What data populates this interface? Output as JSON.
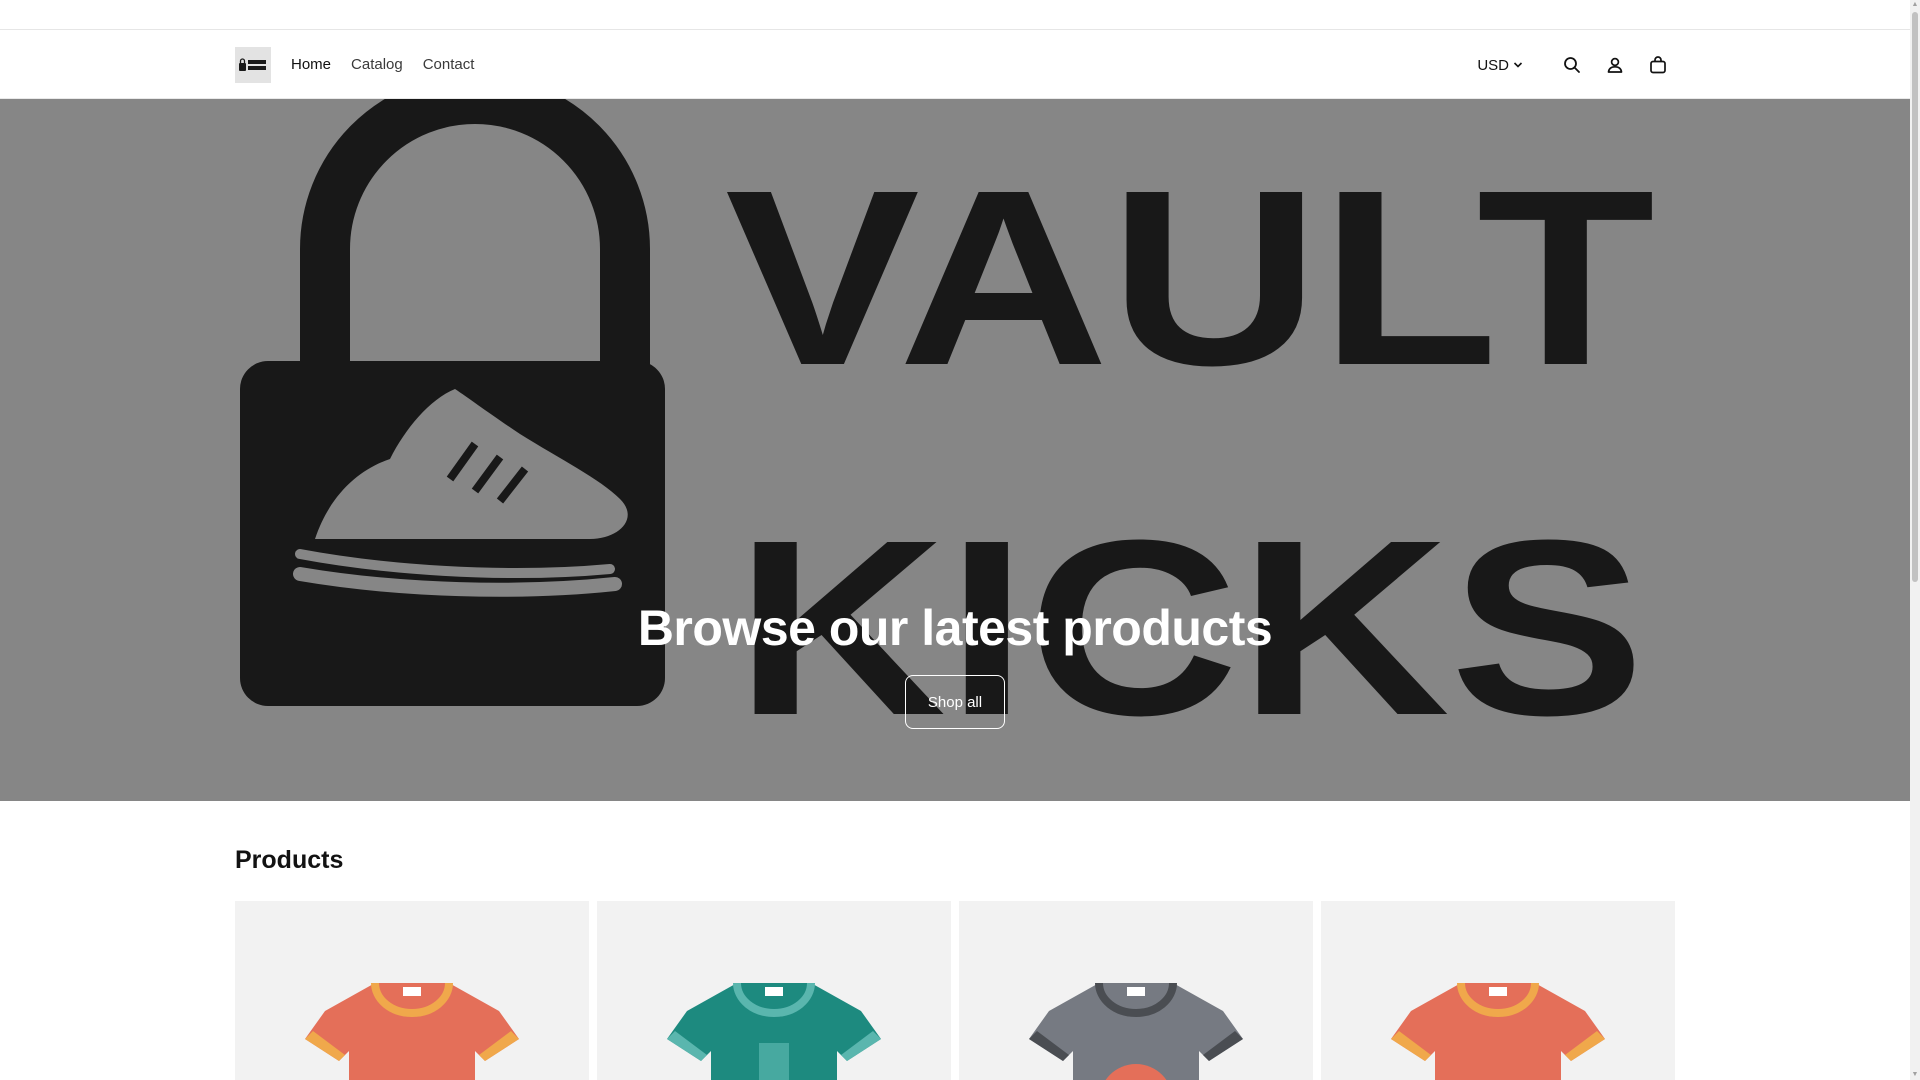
{
  "header": {
    "logo_alt": "VAULT KICKS",
    "nav": [
      {
        "label": "Home"
      },
      {
        "label": "Catalog"
      },
      {
        "label": "Contact"
      }
    ],
    "currency": "USD",
    "icons": [
      "search-icon",
      "account-icon",
      "cart-icon"
    ]
  },
  "hero": {
    "brand_line1": "VAULT",
    "brand_line2": "KICKS",
    "title": "Browse our latest products",
    "button": "Shop all"
  },
  "products": {
    "heading": "Products",
    "items": [
      {
        "shirt_color": "#e46f59",
        "collar_color": "#f0a84b",
        "style": "plain"
      },
      {
        "shirt_color": "#1d8a7f",
        "collar_color": "#5ab6ae",
        "style": "pocket"
      },
      {
        "shirt_color": "#767a82",
        "collar_color": "#4a4d52",
        "style": "graphic"
      },
      {
        "shirt_color": "#e46f59",
        "collar_color": "#f0a84b",
        "style": "plain"
      }
    ]
  },
  "colors": {
    "hero_bg": "#8d8d8d",
    "ink": "#121212"
  }
}
